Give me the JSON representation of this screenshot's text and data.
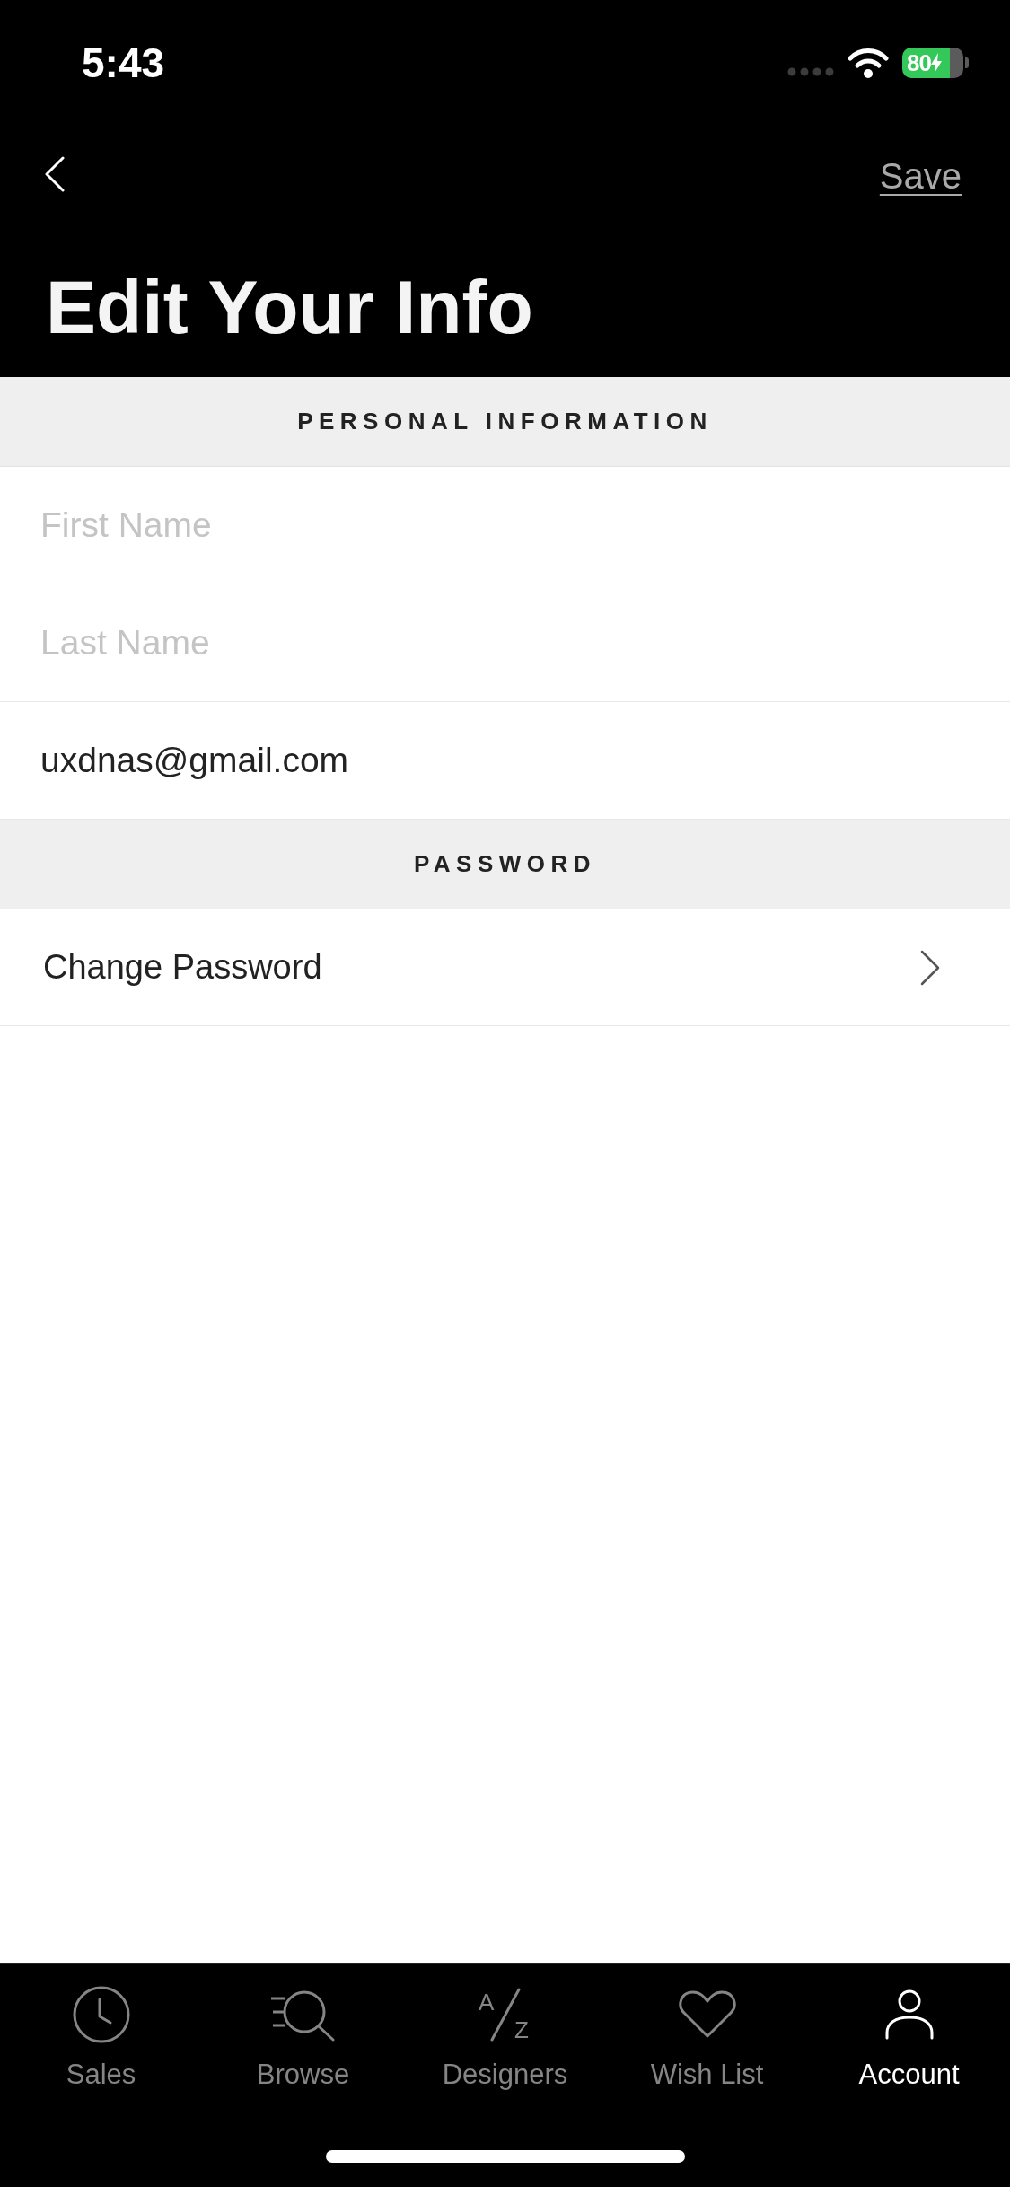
{
  "status_bar": {
    "time": "5:43",
    "battery": {
      "label": "80",
      "charging": true
    }
  },
  "nav_bar": {
    "save": "Save"
  },
  "title": "Edit Your Info",
  "sections": [
    {
      "title": "PERSONAL INFORMATION",
      "rows": [
        {
          "kind": "field",
          "placeholder": "First Name"
        },
        {
          "kind": "field",
          "placeholder": "Last Name"
        },
        {
          "kind": "field",
          "value": "uxdnas@gmail.com"
        }
      ]
    },
    {
      "title": "PASSWORD",
      "rows": [
        {
          "kind": "link",
          "label": "Change Password"
        }
      ]
    }
  ],
  "tab_bar": {
    "tabs": [
      {
        "label": "Sales",
        "kind": "clock",
        "selected": false
      },
      {
        "label": "Browse",
        "kind": "search",
        "selected": false
      },
      {
        "label": "Designers",
        "kind": "az",
        "icon_letters": [
          "A",
          "Z"
        ],
        "selected": false
      },
      {
        "label": "Wish List",
        "kind": "heart",
        "selected": false
      },
      {
        "label": "Account",
        "kind": "person",
        "selected": true
      }
    ]
  }
}
